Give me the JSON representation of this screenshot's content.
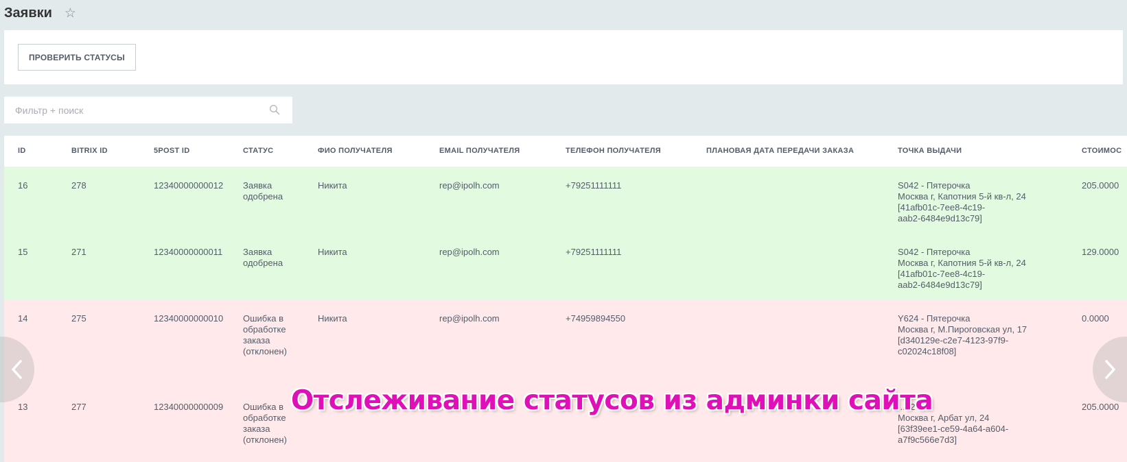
{
  "header": {
    "title": "Заявки",
    "star_icon": "star-icon"
  },
  "toolbar": {
    "check_statuses_label": "ПРОВЕРИТЬ СТАТУСЫ"
  },
  "filter": {
    "placeholder": "Фильтр + поиск",
    "value": ""
  },
  "table": {
    "columns": [
      "ID",
      "BITRIX ID",
      "5POST ID",
      "СТАТУС",
      "ФИО ПОЛУЧАТЕЛЯ",
      "EMAIL ПОЛУЧАТЕЛЯ",
      "ТЕЛЕФОН ПОЛУЧАТЕЛЯ",
      "ПЛАНОВАЯ ДАТА ПЕРЕДАЧИ ЗАКАЗА",
      "ТОЧКА ВЫДАЧИ",
      "СТОИМОС"
    ],
    "rows": [
      {
        "state": "success",
        "id": "16",
        "bitrix_id": "278",
        "post_id": "12340000000012",
        "status": "Заявка одобрена",
        "name": "Никита",
        "email": "rep@ipolh.com",
        "phone": "+79251111111",
        "planned_date": "",
        "point_lines": [
          "S042 - Пятерочка",
          "Москва г, Капотния 5-й кв-л, 24",
          "[41afb01c-7ee8-4c19-",
          "aab2-6484e9d13c79]"
        ],
        "cost": "205.0000"
      },
      {
        "state": "success",
        "id": "15",
        "bitrix_id": "271",
        "post_id": "12340000000011",
        "status": "Заявка одобрена",
        "name": "Никита",
        "email": "rep@ipolh.com",
        "phone": "+79251111111",
        "planned_date": "",
        "point_lines": [
          "S042 - Пятерочка",
          "Москва г, Капотния 5-й кв-л, 24",
          "[41afb01c-7ee8-4c19-",
          "aab2-6484e9d13c79]"
        ],
        "cost": "129.0000"
      },
      {
        "state": "error",
        "id": "14",
        "bitrix_id": "275",
        "post_id": "12340000000010",
        "status": "Ошибка в обработке заказа (отклонен)",
        "name": "Никита",
        "email": "rep@ipolh.com",
        "phone": "+74959894550",
        "planned_date": "",
        "point_lines": [
          "Y624 - Пятерочка",
          "Москва г, М.Пироговская ул, 17",
          "[d340129e-c2e7-4123-97f9-",
          "c02024c18f08]"
        ],
        "cost": "0.0000"
      },
      {
        "state": "error",
        "id": "13",
        "bitrix_id": "277",
        "post_id": "12340000000009",
        "status": "Ошибка в обработке заказа (отклонен)",
        "name": "",
        "email": "",
        "phone": "",
        "planned_date": "",
        "point_lines": [
          "...02028",
          "Москва г, Арбат ул, 24",
          "[63f39ee1-ce59-4a64-a604-",
          "a7f9c566e7d3]"
        ],
        "cost": "205.0000"
      }
    ]
  },
  "carousel": {
    "prev_icon": "chevron-left-icon",
    "next_icon": "chevron-right-icon"
  },
  "overlay": {
    "caption": "Отслеживание статусов из админки сайта"
  },
  "colors": {
    "success_row": "#e2fbe0",
    "error_row": "#ffe9ea",
    "caption": "#e010b8"
  }
}
